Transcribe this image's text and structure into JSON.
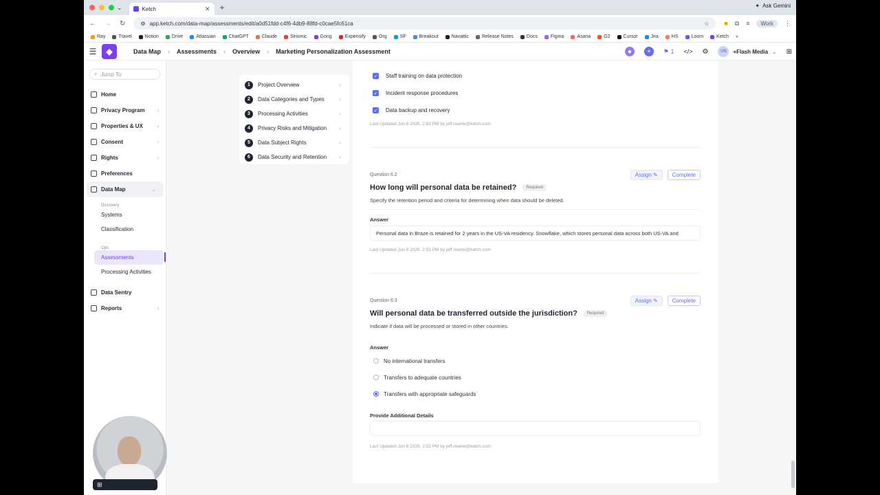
{
  "browser": {
    "tab_title": "Ketch",
    "url": "app.ketch.com/data-map/assessments/edit/a0d51fdd-c4f6-4db9-88fd-c0cae5fc61ca",
    "gemini_label": "Ask Gemini",
    "profile_label": "Work",
    "bookmarks": [
      "Ray",
      "Travel",
      "Notion",
      "Drive",
      "Atlassian",
      "ChatGPT",
      "Claude",
      "Seismic",
      "Gong",
      "Expensify",
      "Org",
      "SF",
      "Breakout",
      "Navattic",
      "Release Notes",
      "Docs",
      "Figma",
      "Asana",
      "G2",
      "Cursor",
      "Jira",
      "HS",
      "Loom",
      "Ketch"
    ],
    "bookmarks_more": "»"
  },
  "appbar": {
    "crumbs": [
      "Data Map",
      "Assessments",
      "Overview",
      "Marketing Personalization Assessment"
    ],
    "notif_count": "1",
    "avatar_initials": "UN",
    "org_name": "+Flash Media"
  },
  "sidebar": {
    "jump_placeholder": "Jump To",
    "items": [
      {
        "label": "Home",
        "arrow": ""
      },
      {
        "label": "Privacy Program",
        "arrow": "›"
      },
      {
        "label": "Properties & UX",
        "arrow": "›"
      },
      {
        "label": "Consent",
        "arrow": "›"
      },
      {
        "label": "Rights",
        "arrow": "›"
      },
      {
        "label": "Preferences",
        "arrow": ""
      },
      {
        "label": "Data Map",
        "arrow": "⌄"
      }
    ],
    "discovery_header": "Discovery",
    "discovery_items": [
      "Systems",
      "Classification"
    ],
    "ops_header": "Ops",
    "ops_items": [
      "Assessments",
      "Processing Activities"
    ],
    "bottom_items": [
      {
        "label": "Data Sentry",
        "arrow": ""
      },
      {
        "label": "Reports",
        "arrow": "›"
      }
    ]
  },
  "steps": [
    {
      "num": "1",
      "label": "Project Overview"
    },
    {
      "num": "2",
      "label": "Data Categories and Types"
    },
    {
      "num": "3",
      "label": "Processing Activities"
    },
    {
      "num": "4",
      "label": "Privacy Risks and Mitigation"
    },
    {
      "num": "5",
      "label": "Data Subject Rights"
    },
    {
      "num": "6",
      "label": "Data Security and Retention"
    }
  ],
  "section_top": {
    "checks": [
      "Staff training on data protection",
      "Incident response procedures",
      "Data backup and recovery"
    ],
    "updated": "Last Updated Jun 8 2026, 2:53 PM by jeff.reame@ketch.com"
  },
  "q62": {
    "number": "Question 6.2",
    "title": "How long will personal data be retained?",
    "required": "Required",
    "description": "Specify the retention period and criteria for determining when data should be deleted.",
    "answer_label": "Answer",
    "answer": "Personal data in Braze is retained for 2 years in the US-VA residency. Snowflake, which stores personal data across both US-VA and",
    "updated": "Last Updated Jun 8 2026, 2:53 PM by jeff.reame@ketch.com",
    "assign": "Assign",
    "complete": "Complete"
  },
  "q63": {
    "number": "Question 6.3",
    "title": "Will personal data be transferred outside the jurisdiction?",
    "required": "Required",
    "description": "Indicate if data will be processed or stored in other countries.",
    "answer_label": "Answer",
    "options": [
      "No international transfers",
      "Transfers to adequate countries",
      "Transfers with appropriate safeguards"
    ],
    "selected_index": 2,
    "details_label": "Provide Additional Details",
    "updated": "Last Updated Jun 8 2026, 2:53 PM by jeff.reame@ketch.com",
    "assign": "Assign",
    "complete": "Complete"
  },
  "colors": {
    "brand": "#7b3ff2",
    "accent": "#5b6ef5"
  }
}
